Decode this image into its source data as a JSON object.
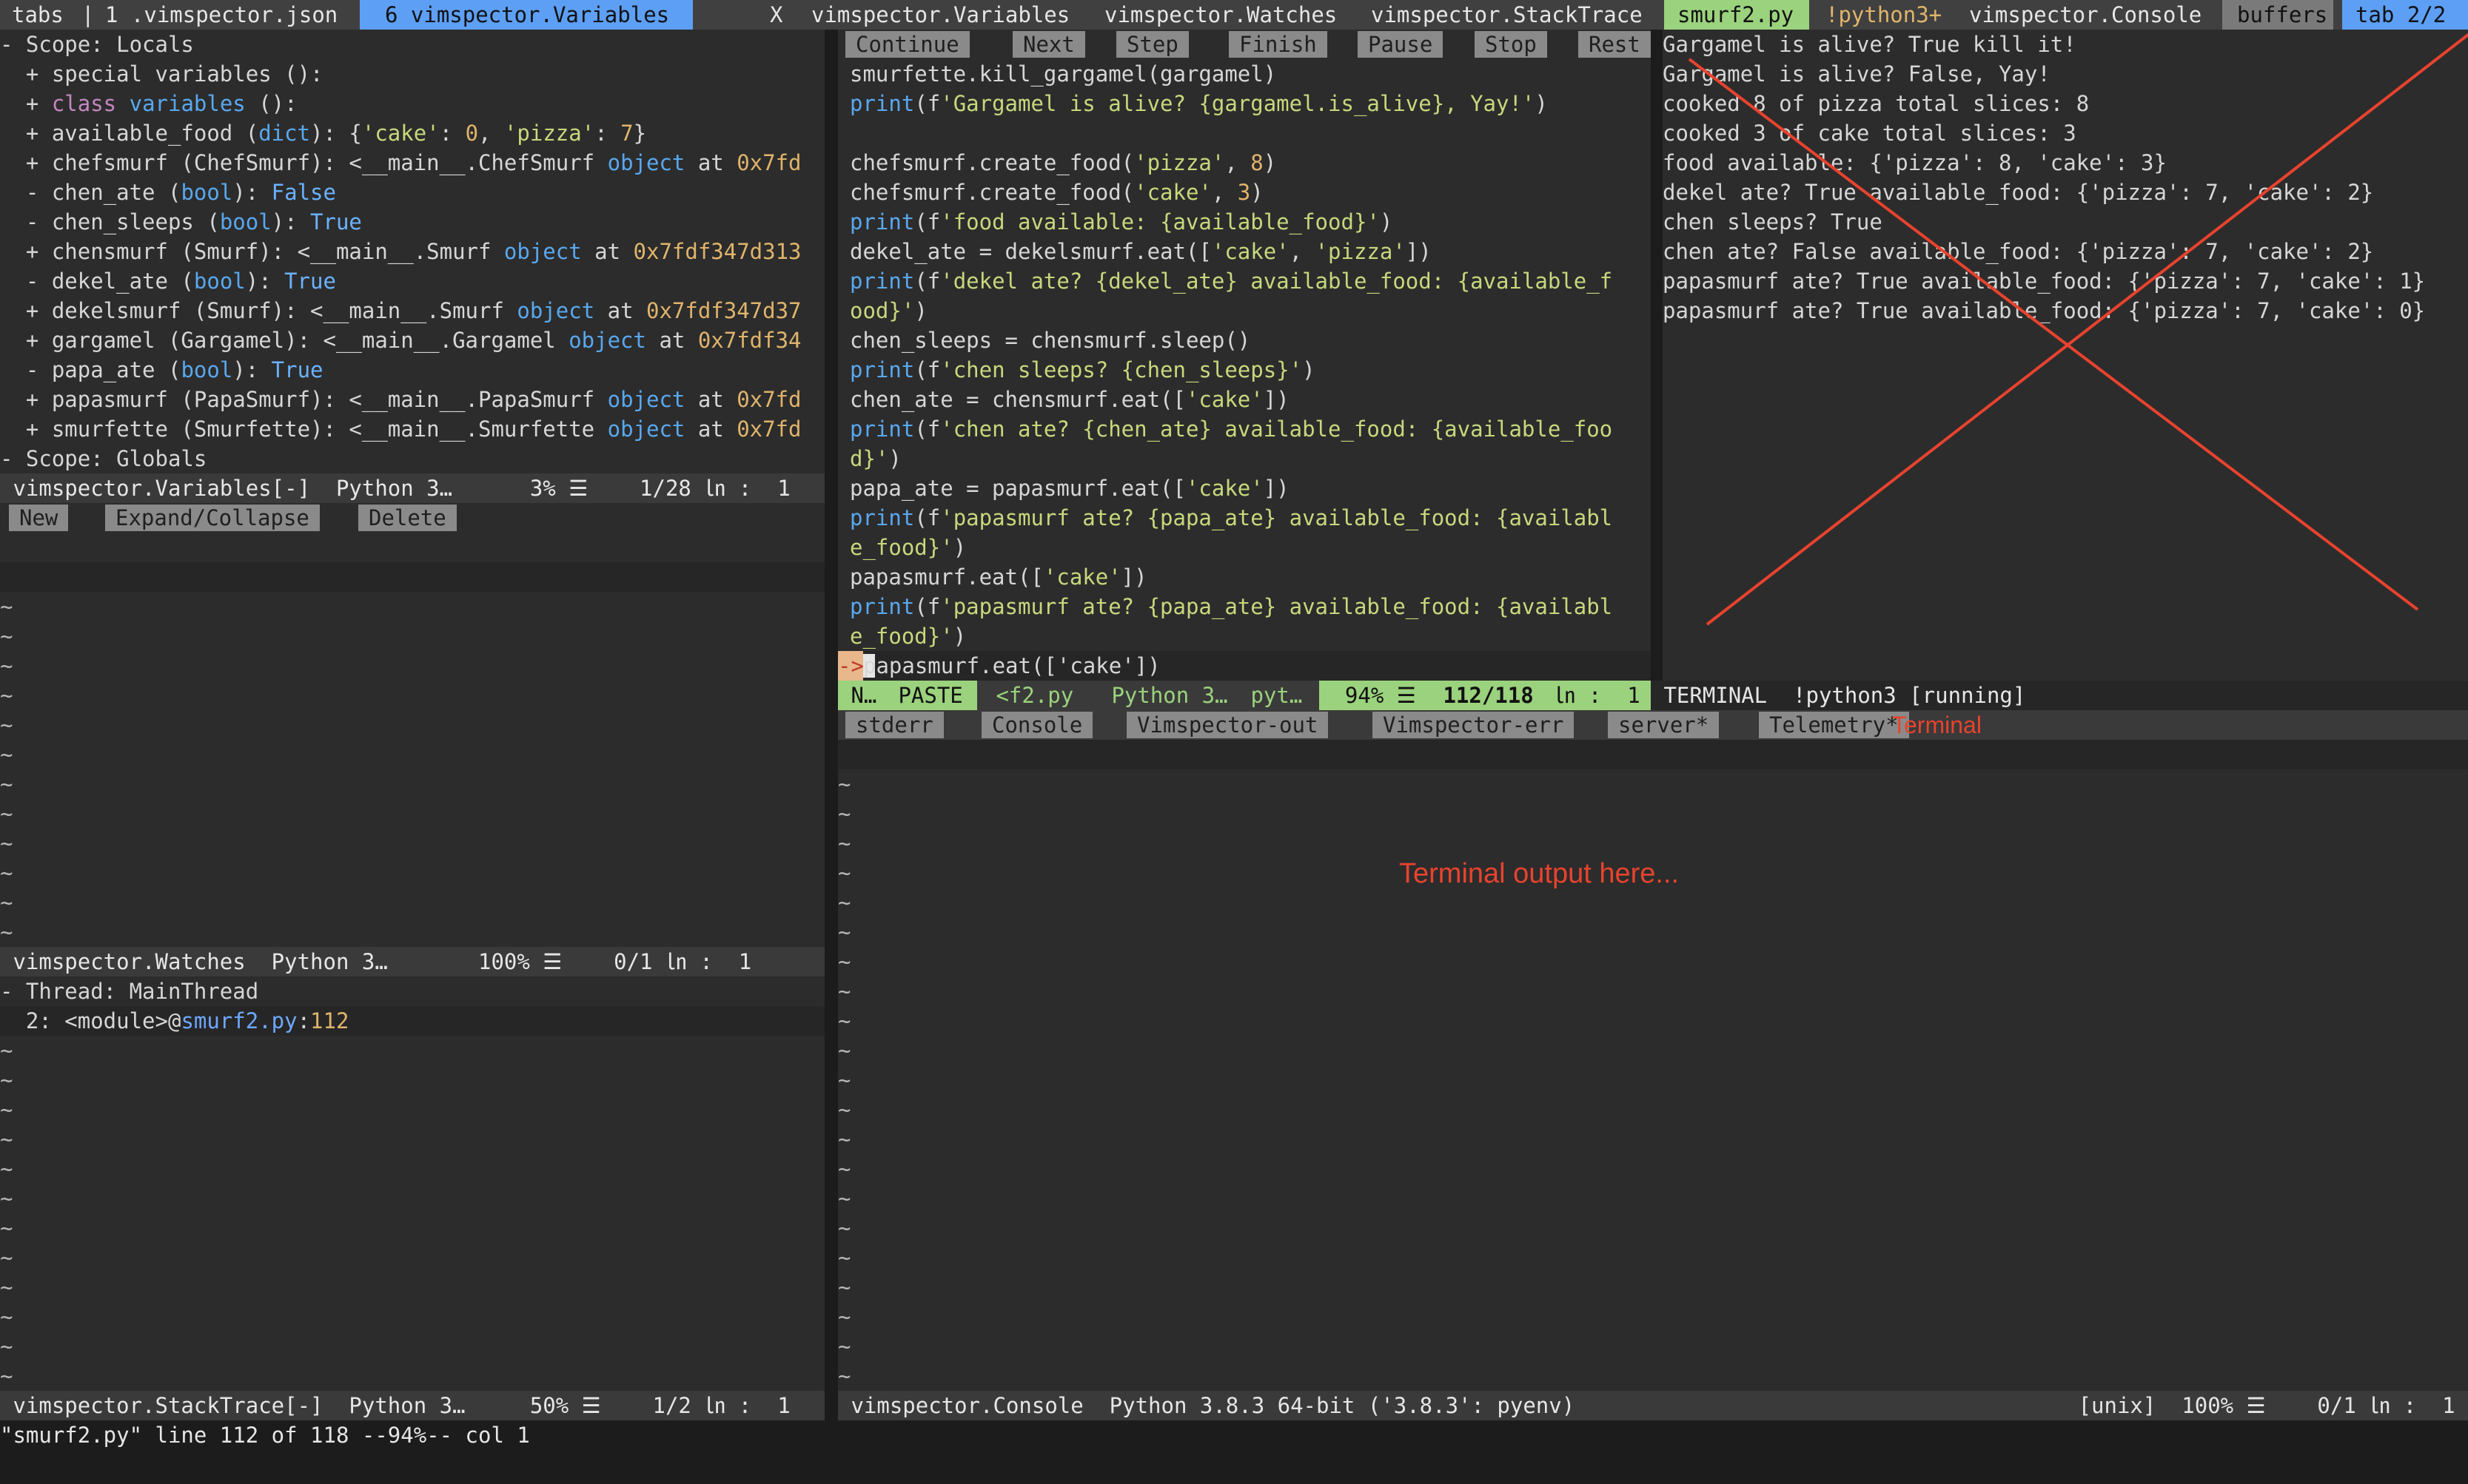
{
  "tabline": {
    "tabs_label": "tabs",
    "tab1": "1 .vimspector.json",
    "tab6": "6 vimspector.Variables",
    "close": "X",
    "b_variables": "vimspector.Variables",
    "b_watches": "vimspector.Watches",
    "b_stacktrace": "vimspector.StackTrace",
    "b_smurf": "smurf2.py",
    "b_python": "!python3+",
    "b_console": "vimspector.Console",
    "buffers": "buffers",
    "tab_count": "tab 2/2"
  },
  "variables": {
    "lines": [
      "- Scope: Locals",
      "  + special variables ():",
      "  + class variables ():",
      "  + available_food (dict): {'cake': 0, 'pizza': 7}",
      "  + chefsmurf (ChefSmurf): <__main__.ChefSmurf object at 0x7fd",
      "  - chen_ate (bool): False",
      "  - chen_sleeps (bool): True",
      "  + chensmurf (Smurf): <__main__.Smurf object at 0x7fdf347d313",
      "  - dekel_ate (bool): True",
      "  + dekelsmurf (Smurf): <__main__.Smurf object at 0x7fdf347d37",
      "  + gargamel (Gargamel): <__main__.Gargamel object at 0x7fdf34",
      "  - papa_ate (bool): True",
      "  + papasmurf (PapaSmurf): <__main__.PapaSmurf object at 0x7fd",
      "  + smurfette (Smurfette): <__main__.Smurfette object at 0x7fd",
      "- Scope: Globals"
    ],
    "status": " vimspector.Variables[-]  Python 3…      3% ☰    1/28 ㏑ :  1"
  },
  "watch_buttons": {
    "new": "New",
    "expand": "Expand/Collapse",
    "delete": "Delete"
  },
  "watches": {
    "status": " vimspector.Watches  Python 3…       100% ☰    0/1 ㏑ :  1"
  },
  "stack": {
    "thread": "- Thread: MainThread",
    "frame": "  2: <module>@smurf2.py:112",
    "status": " vimspector.StackTrace[-]  Python 3…     50% ☰    1/2 ㏑ :  1"
  },
  "toolbar": {
    "continue": "Continue",
    "next": "Next",
    "step": "Step",
    "finish": "Finish",
    "pause": "Pause",
    "stop": "Stop",
    "restart": "Rest"
  },
  "code": {
    "lines": [
      "  smurfette.kill_gargamel(gargamel)",
      "  print(f'Gargamel is alive? {gargamel.is_alive}, Yay!')",
      "",
      "  chefsmurf.create_food('pizza', 8)",
      "  chefsmurf.create_food('cake', 3)",
      "  print(f'food available: {available_food}')",
      "  dekel_ate = dekelsmurf.eat(['cake', 'pizza'])",
      "  print(f'dekel ate? {dekel_ate} available_food: {available_f",
      "  ood}')",
      "  chen_sleeps = chensmurf.sleep()",
      "  print(f'chen sleeps? {chen_sleeps}')",
      "  chen_ate = chensmurf.eat(['cake'])",
      "  print(f'chen ate? {chen_ate} available_food: {available_foo",
      "  d}')",
      "  papa_ate = papasmurf.eat(['cake'])",
      "  print(f'papasmurf ate? {papa_ate} available_food: {availabl",
      "  e_food}')",
      "  papasmurf.eat(['cake'])",
      "  print(f'papasmurf ate? {papa_ate} available_food: {availabl",
      "  e_food}')"
    ],
    "pc_marker": "->",
    "current_line": "papasmurf.eat(['cake'])",
    "status": {
      "mode": " N…",
      "paste": " PASTE ",
      "file": " <f2.py ",
      "lang": " Python 3… ",
      "ft": " pyt… ",
      "percent": "  94% ☰ ",
      "pos": " 112/118 ",
      "ln": " ㏑ :  1 "
    }
  },
  "output": {
    "lines": [
      "Gargamel is alive? True kill it!",
      "Gargamel is alive? False, Yay!",
      "cooked 8 of pizza total slices: 8",
      "cooked 3 of cake total slices: 3",
      "food available: {'pizza': 8, 'cake': 3}",
      "dekel ate? True available_food: {'pizza': 7, 'cake': 2}",
      "chen sleeps? True",
      "chen ate? False available_food: {'pizza': 7, 'cake': 2}",
      "papasmurf ate? True available_food: {'pizza': 7, 'cake': 1}",
      "papasmurf ate? True available_food: {'pizza': 7, 'cake': 0}"
    ],
    "status": " TERMINAL  !python3 [running]"
  },
  "console_tabs": {
    "stderr": "stderr",
    "console": "Console",
    "out": "Vimspector-out",
    "err": "Vimspector-err",
    "server": "server*",
    "telemetry": "Telemetry*",
    "terminal": "Terminal"
  },
  "console": {
    "placeholder": "Terminal output here...",
    "status_left": " vimspector.Console  Python 3.8.3 64-bit ('3.8.3': pyenv)",
    "status_right": "[unix]  100% ☰    0/1 ㏑ :  1 "
  },
  "cmdline": "\"smurf2.py\" line 112 of 118 --94%-- col 1",
  "colors": {
    "accent_blue": "#6ea8ff",
    "green": "#9bd27d",
    "annotation_red": "#e8432e"
  }
}
